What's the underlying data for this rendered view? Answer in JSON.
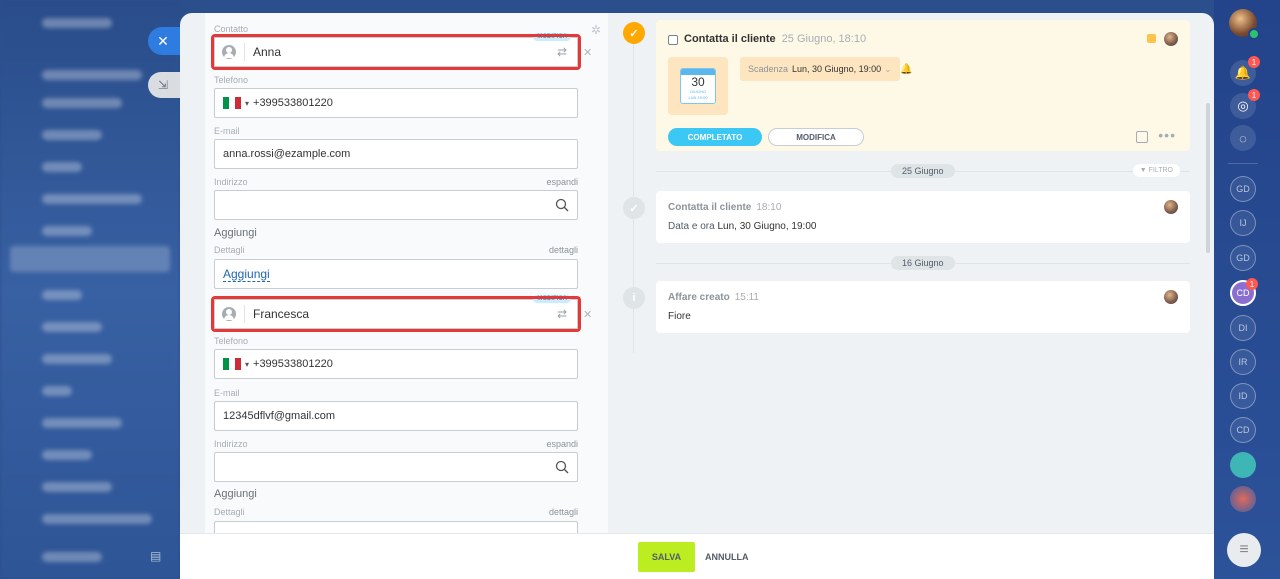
{
  "form": {
    "contact1": {
      "label": "Contatto",
      "name": "Anna",
      "tag": "MODIFICA",
      "phone_label": "Telefono",
      "phone": "+399533801220",
      "email_label": "E-mail",
      "email": "anna.rossi@ezample.com",
      "address_label": "Indirizzo",
      "address_expand": "espandi",
      "add_plain": "Aggiungi",
      "details_label": "Dettagli",
      "details_right": "dettagli",
      "add_link": "Aggiungi"
    },
    "contact2": {
      "name": "Francesca",
      "tag": "MODIFICA",
      "phone_label": "Telefono",
      "phone": "+399533801220",
      "email_label": "E-mail",
      "email": "12345dflvf@gmail.com",
      "address_label": "Indirizzo",
      "address_expand": "espandi",
      "add_plain": "Aggiungi",
      "details_label": "Dettagli",
      "details_right": "dettagli"
    },
    "flag_colors": [
      "#009246",
      "#ffffff",
      "#ce2b37"
    ]
  },
  "timeline": {
    "task": {
      "title": "Contatta il cliente",
      "time": "25 Giugno, 18:10",
      "calendar_num": "30",
      "calendar_month": "GIUGNO",
      "calendar_day": "LUN 19:00",
      "deadline_label": "Scadenza",
      "deadline_value": "Lun, 30 Giugno, 19:00",
      "complete_label": "COMPLETATO",
      "edit_label": "MODIFICA"
    },
    "date1": "25 Giugno",
    "filter_label": "FILTRO",
    "entry1": {
      "title": "Contatta il cliente",
      "time": "18:10",
      "body_label": "Data e ora",
      "body_value": "Lun, 30 Giugno, 19:00"
    },
    "date2": "16 Giugno",
    "entry2": {
      "title": "Affare creato",
      "time": "15:11",
      "body": "Fiore"
    }
  },
  "footer": {
    "save_label": "SALVA",
    "cancel_label": "ANNULLA"
  },
  "right_bar": {
    "badges": [
      "1",
      "1",
      "1"
    ],
    "avatars": [
      "GD",
      "IJ",
      "GD",
      "CD",
      "DI",
      "IR",
      "ID",
      "CD"
    ]
  },
  "colors": {
    "accent": "#3bc8f5",
    "save": "#bbed21",
    "highlight": "#e53838",
    "task_bg": "#fef9e6"
  }
}
